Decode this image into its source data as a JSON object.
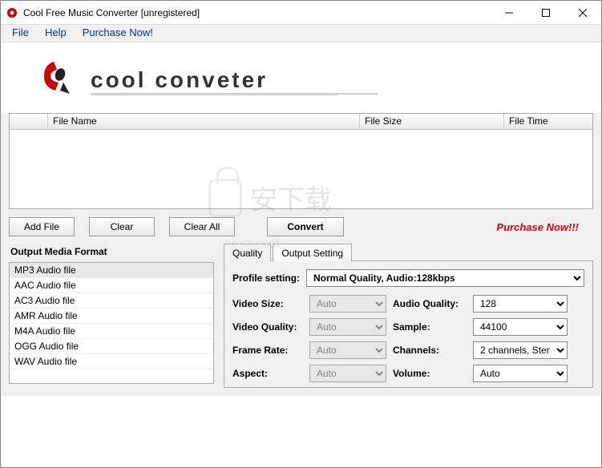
{
  "window": {
    "title": "Cool Free Music Converter  [unregistered]"
  },
  "menu": {
    "file": "File",
    "help": "Help",
    "purchase": "Purchase Now!"
  },
  "logo": {
    "text": "cool conveter"
  },
  "table": {
    "col_filename": "File Name",
    "col_filesize": "File Size",
    "col_filetime": "File Time"
  },
  "buttons": {
    "add_file": "Add File",
    "clear": "Clear",
    "clear_all": "Clear All",
    "convert": "Convert",
    "purchase_now": "Purchase Now!!!"
  },
  "output_format": {
    "title": "Output Media Format",
    "items": [
      "MP3 Audio file",
      "AAC Audio file",
      "AC3 Audio file",
      "AMR Audio file",
      "M4A Audio file",
      "OGG Audio file",
      "WAV Audio file"
    ]
  },
  "tabs": {
    "quality": "Quality",
    "output_setting": "Output Setting"
  },
  "settings": {
    "profile_label": "Profile setting:",
    "profile_value": "Normal Quality, Audio:128kbps",
    "video_size_label": "Video Size:",
    "video_size_value": "Auto",
    "video_quality_label": "Video Quality:",
    "video_quality_value": "Auto",
    "frame_rate_label": "Frame Rate:",
    "frame_rate_value": "Auto",
    "aspect_label": "Aspect:",
    "aspect_value": "Auto",
    "audio_quality_label": "Audio Quality:",
    "audio_quality_value": "128",
    "sample_label": "Sample:",
    "sample_value": "44100",
    "channels_label": "Channels:",
    "channels_value": "2 channels, Ster",
    "volume_label": "Volume:",
    "volume_value": "Auto"
  },
  "watermark": {
    "text": "安下载",
    "sub": "anxz.com"
  }
}
